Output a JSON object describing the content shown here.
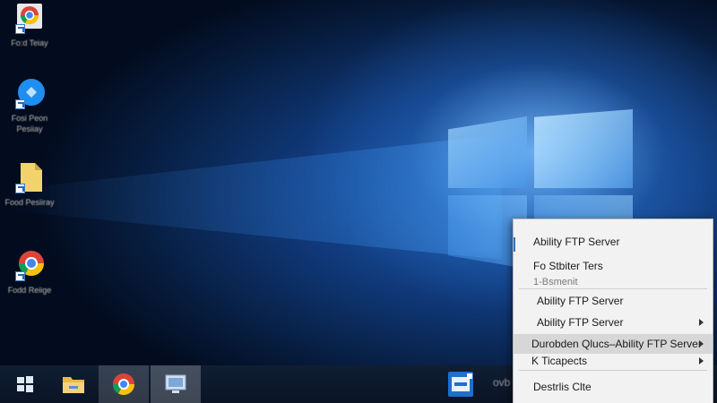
{
  "desktop": {
    "icons": [
      {
        "caption": "Fo:d Teiay",
        "icon": "chrome-app-icon"
      },
      {
        "caption": "Fosi Peon Pesiiay",
        "icon": "blue-app-icon"
      },
      {
        "caption": "Food Pesiiray",
        "icon": "file-icon"
      },
      {
        "caption": "Fodd Reiige",
        "icon": "chrome-icon"
      }
    ]
  },
  "taskbar": {
    "partial_text": "ovb",
    "buttons": [
      {
        "icon": "start-icon"
      },
      {
        "icon": "file-explorer-icon"
      },
      {
        "icon": "chrome-icon"
      },
      {
        "icon": "monitor-icon"
      },
      {
        "icon": "ftp-server-icon"
      }
    ]
  },
  "context_menu": {
    "items": [
      {
        "label": "Ability FTP Server"
      },
      {
        "label": "Fo Stbiter Ters"
      },
      {
        "label": "1-Bsmenit"
      },
      {
        "label": "Ability FTP Server"
      },
      {
        "label": "Ability FTP Server",
        "submenu": true
      },
      {
        "label": "Durobden Qlucs–Ability FTP Server",
        "submenu": true,
        "highlighted": true
      },
      {
        "label": "K Ticapects",
        "submenu": true
      },
      {
        "label": "Destrlis Clte"
      }
    ]
  }
}
